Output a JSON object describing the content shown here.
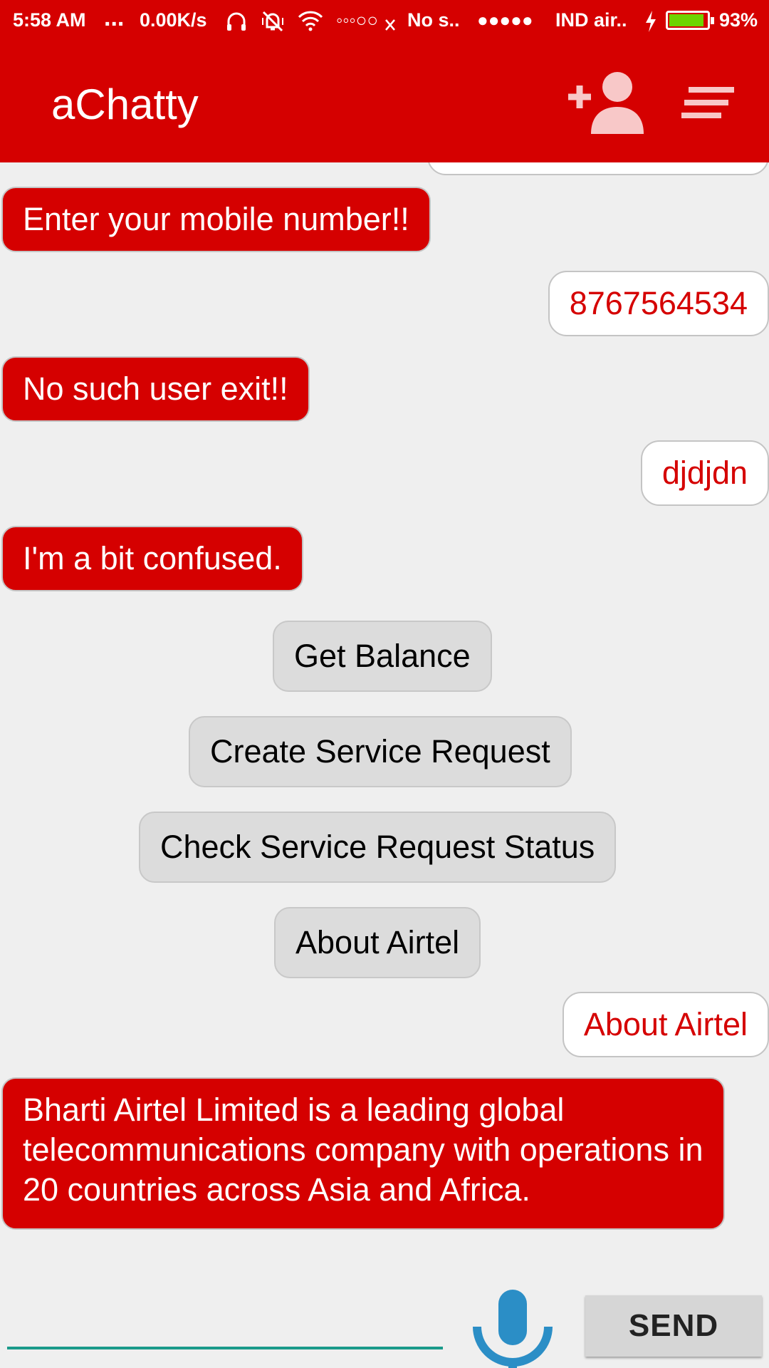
{
  "status_bar": {
    "time": "5:58 AM",
    "dots": "...",
    "speed": "0.00K/s",
    "signal_dots": "◦◦◦○○",
    "no_sim": "No s..",
    "carrier_dots": "●●●●●",
    "carrier": "IND air..",
    "battery_percent": "93%",
    "battery_level": 0.93,
    "icons": [
      "headset-icon",
      "vibrate-off-icon",
      "wifi-icon",
      "charging-icon",
      "battery-icon"
    ]
  },
  "appbar": {
    "title": "aChatty",
    "icons": [
      "add-user-icon",
      "menu-icon"
    ]
  },
  "chat": {
    "messages": [
      {
        "from": "bot",
        "text": "Enter your mobile number!!"
      },
      {
        "from": "user",
        "text": "8767564534"
      },
      {
        "from": "bot",
        "text": "No such user exit!!"
      },
      {
        "from": "user",
        "text": "djdjdn"
      },
      {
        "from": "bot",
        "text": "I'm a bit confused."
      },
      {
        "from": "user",
        "text": "About Airtel"
      },
      {
        "from": "bot",
        "text": "Bharti Airtel Limited is a leading global telecommunications company with operations in 20 countries across Asia and Africa."
      }
    ],
    "quick_replies": [
      "Get Balance",
      "Create Service Request",
      "Check Service Request Status",
      "About Airtel"
    ]
  },
  "input_bar": {
    "value": "",
    "send_label": "SEND",
    "mic_icon": "microphone-icon"
  },
  "colors": {
    "primary": "#d50000",
    "background": "#efefef",
    "chip": "#dcdcdc",
    "mic": "#2b8ec6",
    "input_underline": "#1a9a8a"
  }
}
